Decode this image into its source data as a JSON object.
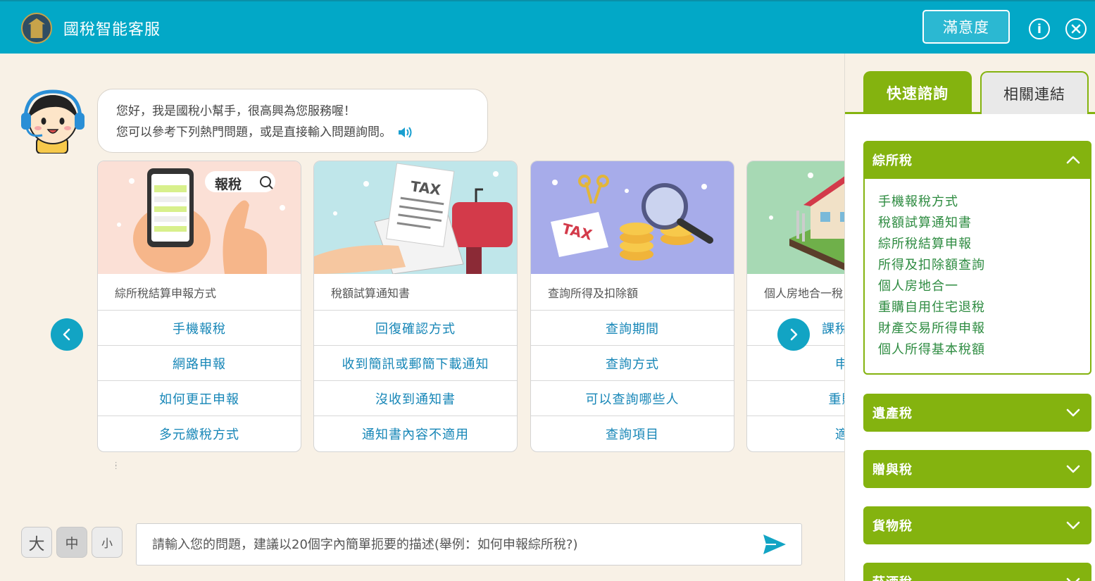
{
  "header": {
    "app_title": "國稅智能客服",
    "satisfaction_label": "滿意度",
    "info_icon": "info-icon",
    "close_icon": "close-icon"
  },
  "bot": {
    "greeting_line1": "您好，我是國稅小幫手，很高興為您服務喔！",
    "greeting_line2": "您可以參考下列熱門問題，或是直接輸入問題詢問。"
  },
  "cards": [
    {
      "title": "綜所稅結算申報方式",
      "image_label": "報稅",
      "links": [
        "手機報稅",
        "網路申報",
        "如何更正申報",
        "多元繳稅方式"
      ]
    },
    {
      "title": "稅額試算通知書",
      "image_label": "TAX",
      "links": [
        "回復確認方式",
        "收到簡訊或郵簡下載通知",
        "沒收到通知書",
        "通知書內容不適用"
      ]
    },
    {
      "title": "查詢所得及扣除額",
      "image_label": "TAX",
      "links": [
        "查詢期間",
        "查詢方式",
        "可以查詢哪些人",
        "查詢項目"
      ]
    },
    {
      "title": "個人房地合一稅",
      "links": [
        "課稅及免",
        "申報",
        "重購退",
        "適用"
      ]
    }
  ],
  "font_sizes": {
    "large": "大",
    "medium": "中",
    "small": "小"
  },
  "chat_input": {
    "placeholder": "請輸入您的問題，建議以20個字內簡單扼要的描述(舉例：如何申報綜所稅?)"
  },
  "sidebar": {
    "tabs": [
      "快速諮詢",
      "相關連結"
    ],
    "sections": [
      {
        "title": "綜所稅",
        "expanded": true,
        "items": [
          "手機報稅方式",
          "稅額試算通知書",
          "綜所稅結算申報",
          "所得及扣除額查詢",
          "個人房地合一",
          "重購自用住宅退稅",
          "財產交易所得申報",
          "個人所得基本稅額"
        ]
      },
      {
        "title": "遺產稅",
        "expanded": false
      },
      {
        "title": "贈與稅",
        "expanded": false
      },
      {
        "title": "貨物稅",
        "expanded": false
      },
      {
        "title": "菸酒稅",
        "expanded": false
      }
    ]
  },
  "colors": {
    "header": "#02a8c7",
    "accent_green": "#84b30f",
    "link_blue": "#1686b7",
    "link_green": "#2d8b40",
    "background": "#f8f1e6"
  }
}
